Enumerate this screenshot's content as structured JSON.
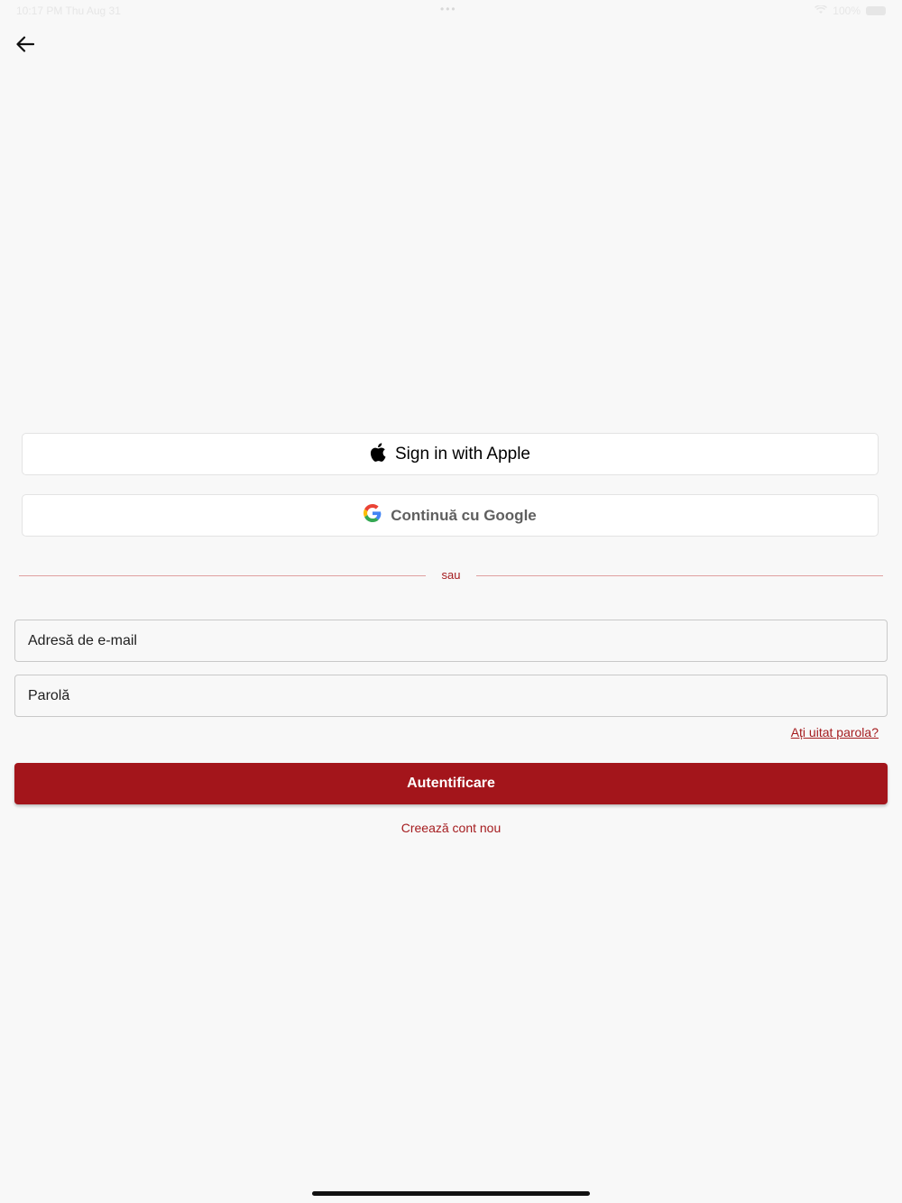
{
  "status_bar": {
    "time": "10:17 PM",
    "date": "Thu Aug 31",
    "dots": "•••",
    "battery": "100%"
  },
  "icons": {
    "back": "arrow-left-icon",
    "apple": "apple-logo-icon",
    "google": "google-logo-icon"
  },
  "social": {
    "apple_label": "Sign in with Apple",
    "google_label": "Continuă cu Google"
  },
  "divider": {
    "text": "sau"
  },
  "form": {
    "email_placeholder": "Adresă de e-mail",
    "password_placeholder": "Parolă",
    "forgot_password": "Ați uitat parola?",
    "submit_label": "Autentificare",
    "create_account": "Creează cont nou"
  },
  "colors": {
    "accent": "#a3151b",
    "background": "#f8f8f8"
  }
}
